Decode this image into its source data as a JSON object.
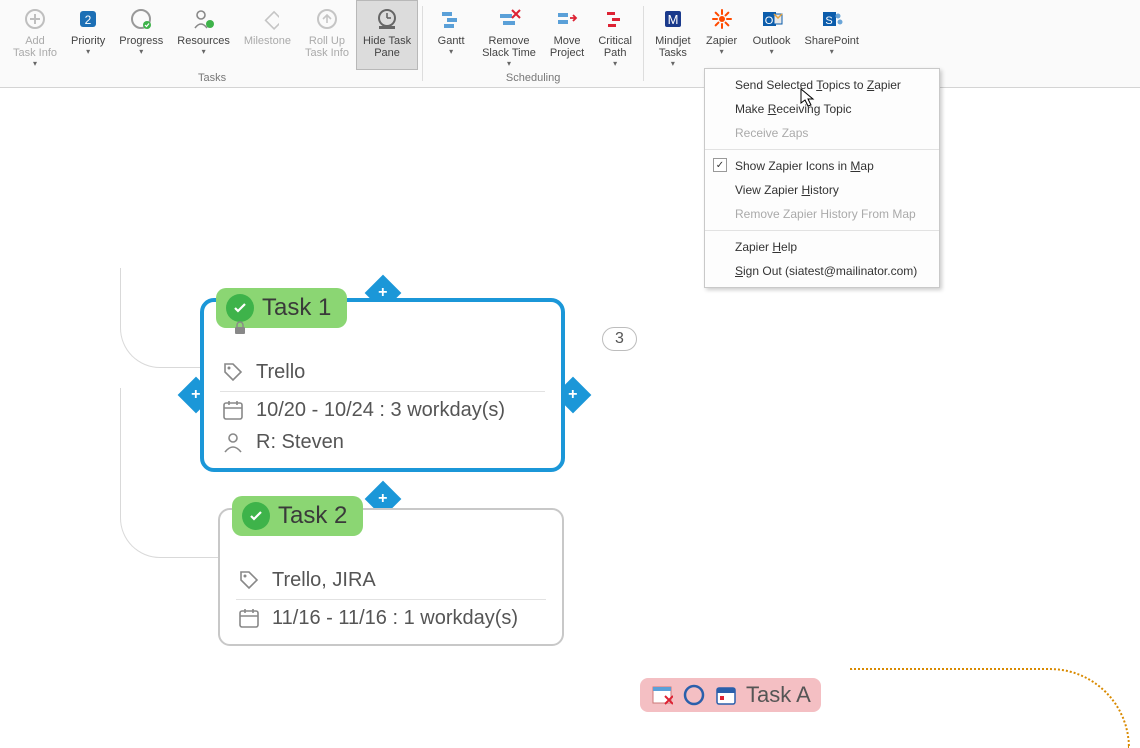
{
  "ribbon": {
    "groups": [
      {
        "name": "tasks",
        "label": "Tasks",
        "items": [
          {
            "id": "add-task-info",
            "label": "Add\nTask Info",
            "disabled": true,
            "caret": true,
            "icon": "add-circle"
          },
          {
            "id": "priority",
            "label": "Priority",
            "badge": "2",
            "caret": true,
            "icon": "priority"
          },
          {
            "id": "progress",
            "label": "Progress",
            "caret": true,
            "icon": "progress"
          },
          {
            "id": "resources",
            "label": "Resources",
            "caret": true,
            "icon": "resources"
          },
          {
            "id": "milestone",
            "label": "Milestone",
            "disabled": true,
            "icon": "milestone"
          },
          {
            "id": "roll-up",
            "label": "Roll Up\nTask Info",
            "disabled": true,
            "icon": "rollup"
          },
          {
            "id": "hide-task-pane",
            "label": "Hide Task\nPane",
            "pressed": true,
            "icon": "hide-pane"
          }
        ]
      },
      {
        "name": "scheduling",
        "label": "Scheduling",
        "items": [
          {
            "id": "gantt",
            "label": "Gantt",
            "caret": true,
            "icon": "gantt"
          },
          {
            "id": "remove-slack",
            "label": "Remove\nSlack Time",
            "caret": true,
            "icon": "remove-slack"
          },
          {
            "id": "move-project",
            "label": "Move\nProject",
            "icon": "move"
          },
          {
            "id": "critical-path",
            "label": "Critical\nPath",
            "caret": true,
            "icon": "critical"
          }
        ]
      },
      {
        "name": "integrations",
        "label": "",
        "items": [
          {
            "id": "mindjet-tasks",
            "label": "Mindjet\nTasks",
            "caret": true,
            "icon": "mindjet"
          },
          {
            "id": "zapier",
            "label": "Zapier",
            "caret": true,
            "icon": "zapier"
          },
          {
            "id": "outlook",
            "label": "Outlook",
            "caret": true,
            "icon": "outlook"
          },
          {
            "id": "sharepoint",
            "label": "SharePoint",
            "caret": true,
            "icon": "sharepoint"
          }
        ]
      }
    ]
  },
  "zapier_menu": {
    "items": [
      {
        "label": "Send Selected Topics to Zapier",
        "mnemonic": [
          "T",
          "Z"
        ]
      },
      {
        "label": "Make Receiving Topic",
        "mnemonic": [
          "R"
        ]
      },
      {
        "label": "Receive Zaps",
        "disabled": true
      },
      {
        "sep": true
      },
      {
        "label": "Show Zapier Icons in Map",
        "checked": true,
        "mnemonic": [
          "M"
        ]
      },
      {
        "label": "View Zapier History",
        "mnemonic": [
          "H"
        ]
      },
      {
        "label": "Remove Zapier History From Map",
        "disabled": true
      },
      {
        "sep": true
      },
      {
        "label": "Zapier Help",
        "mnemonic": [
          "H"
        ]
      },
      {
        "label": "Sign Out (siatest@mailinator.com)",
        "mnemonic": [
          "S"
        ]
      }
    ]
  },
  "card1": {
    "title": "Task 1",
    "tag": "Trello",
    "dates": "10/20 - 10/24 : 3 workday(s)",
    "resource": "R: Steven",
    "badge": "3"
  },
  "card2": {
    "title": "Task 2",
    "tag": "Trello, JIRA",
    "dates": "11/16 - 11/16 : 1 workday(s)"
  },
  "miniTask": {
    "title": "Task A"
  }
}
